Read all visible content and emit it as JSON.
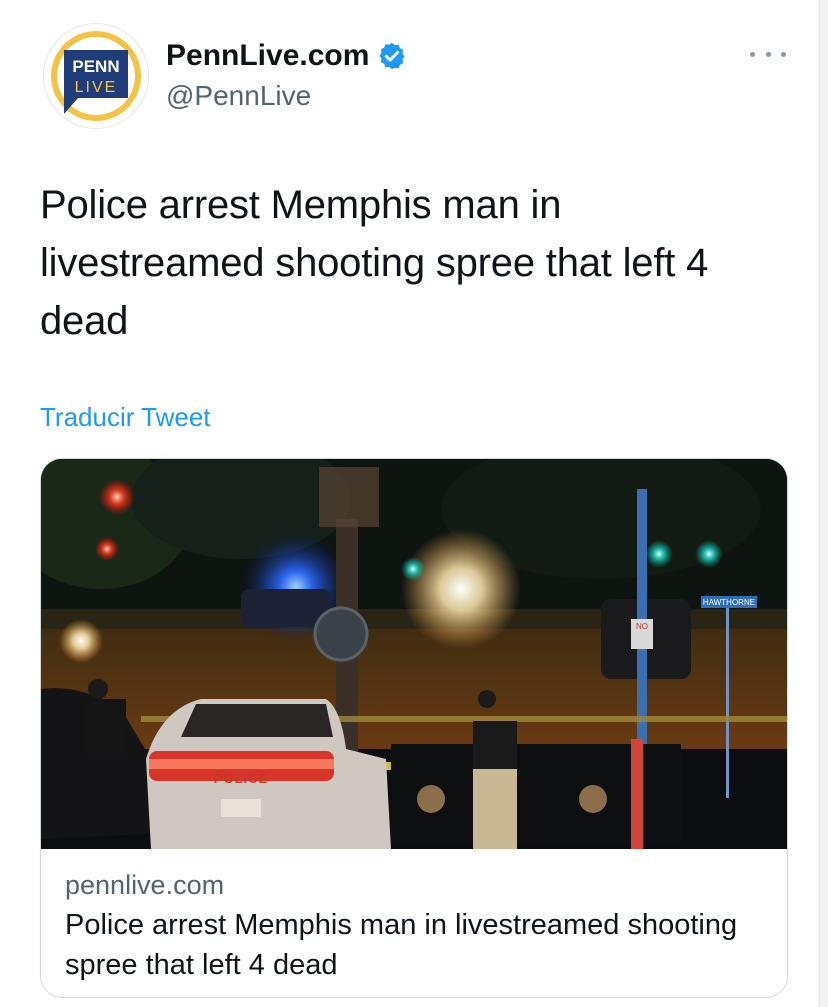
{
  "author": {
    "display_name": "PennLive.com",
    "handle": "@PennLive",
    "avatar": {
      "line1": "PENN",
      "line2": "LIVE",
      "ring_color": "#f5c542",
      "badge_color": "#1f3f7a"
    },
    "verified_color": "#1d9bf0"
  },
  "tweet": {
    "text": "Police arrest Memphis man in livestreamed shooting spree that left 4 dead",
    "translate_label": "Traducir Tweet"
  },
  "card": {
    "domain": "pennlive.com",
    "title": "Police arrest Memphis man in livestreamed shooting spree that left 4 dead",
    "image": {
      "police_label": "POLICE",
      "street_sign": "HAWTHORNE",
      "no_sign": "NO"
    }
  },
  "icons": {
    "more": "more-options-icon",
    "verified": "verified-badge-icon"
  }
}
